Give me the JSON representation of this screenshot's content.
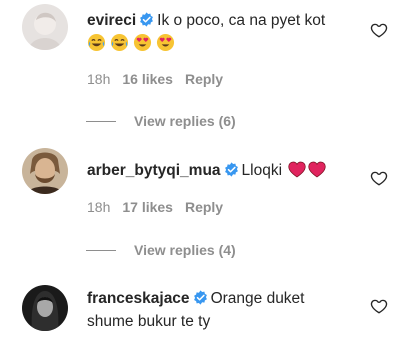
{
  "comments": [
    {
      "username": "evireci",
      "text": "Ik o poco, ca na pyet kot",
      "emojis": [
        "laugh-cry-emoji",
        "laugh-cry-emoji",
        "heart-eyes-emoji",
        "heart-eyes-emoji"
      ],
      "time": "18h",
      "likes": "16 likes",
      "reply": "Reply",
      "view_replies": "View replies (6)"
    },
    {
      "username": "arber_bytyqi_mua",
      "text": "Lloqki",
      "emojis": [
        "red-heart-emoji",
        "red-heart-emoji"
      ],
      "time": "18h",
      "likes": "17 likes",
      "reply": "Reply",
      "view_replies": "View replies (4)"
    },
    {
      "username": "franceskajace",
      "text_line1": "Orange duket",
      "text_line2": "shume bukur te ty"
    }
  ],
  "colors": {
    "verified_blue": "#3897f0",
    "muted_text": "#8e8e8e",
    "primary_text": "#262626",
    "heart_red": "#e0245e"
  }
}
